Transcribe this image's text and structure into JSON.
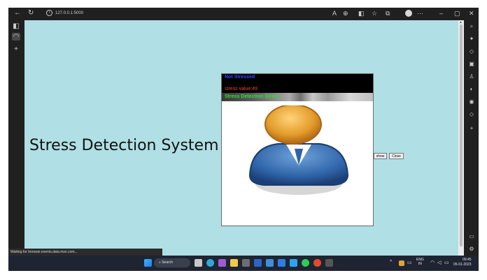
{
  "browser": {
    "url": "127.0.0.1:5000",
    "icons": [
      "back-icon",
      "refresh-icon",
      "info-icon",
      "read-aloud-icon",
      "extensions-icon",
      "split-screen-icon",
      "favorites-icon",
      "collections-icon",
      "profile-icon",
      "more-icon"
    ],
    "window_controls": {
      "minimize": "–",
      "restore": "▢",
      "close": "✕"
    },
    "more_label": "···"
  },
  "page": {
    "heading": "Stress Detection System",
    "capture": {
      "line1": "Not Stressed",
      "line2": "stress value:49",
      "line3": "Stress Detection Stress"
    },
    "show_button": "show",
    "close_button": "Close"
  },
  "status_bar": {
    "text": "Waiting for browser.events.data.msn.com..."
  },
  "taskbar": {
    "search_label": "Search",
    "lang_top": "ENG",
    "lang_bottom": "IN",
    "time": "09:45",
    "date": "05-01-2023"
  },
  "colors": {
    "page_bg": "#b0dfe5",
    "line1": "#3c42ff",
    "line2": "#ff3a3a",
    "line3": "#2ee02e",
    "chrome": "#202020",
    "taskbar": "#1f2432"
  }
}
